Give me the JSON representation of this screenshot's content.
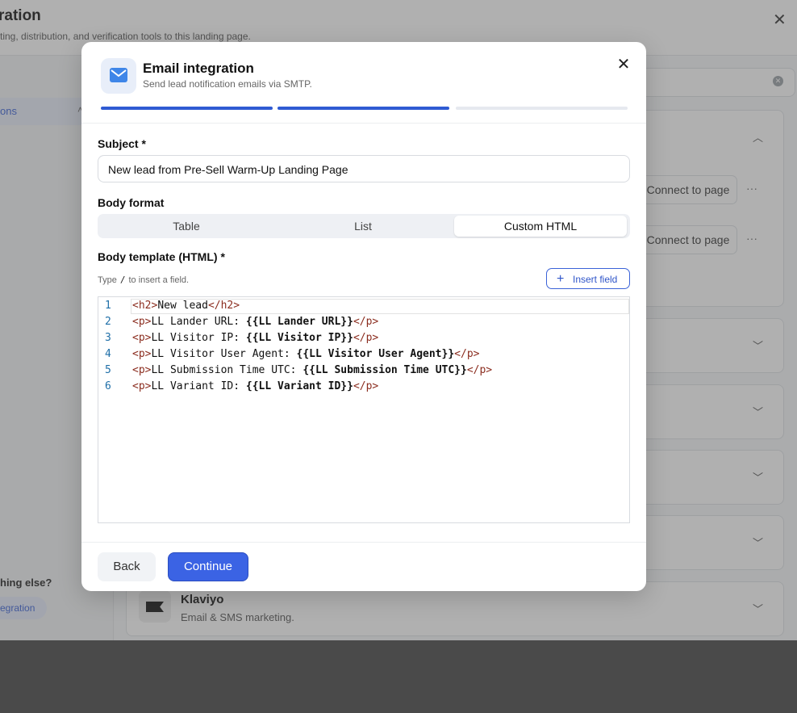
{
  "background": {
    "title": "ration",
    "subtitle": "ting, distribution, and verification tools to this landing page.",
    "sidebar_active": "ons",
    "help_title": "hing else?",
    "help_link": "egration",
    "connect_label": "Connect to page",
    "more_label": "···",
    "klaviyo": {
      "name": "Klaviyo",
      "description": "Email & SMS marketing."
    }
  },
  "modal": {
    "title": "Email integration",
    "subtitle": "Send lead notification emails via SMTP.",
    "steps": {
      "total": 3,
      "completed": 2
    },
    "subject": {
      "label": "Subject *",
      "value": "New lead from Pre-Sell Warm-Up Landing Page"
    },
    "body_format": {
      "label": "Body format",
      "options": [
        "Table",
        "List",
        "Custom HTML"
      ],
      "selected": "Custom HTML"
    },
    "body_template": {
      "label": "Body template (HTML) *",
      "hint_prefix": "Type",
      "hint_key": "/",
      "hint_suffix": "to insert a field.",
      "insert_label": "Insert field",
      "lines": [
        {
          "n": "1",
          "before": "",
          "tag_open": "<h2>",
          "text": "New lead",
          "var": "",
          "tag_close": "</h2>"
        },
        {
          "n": "2",
          "tag_open": "<p>",
          "text": "LL Lander URL: ",
          "var": "{{LL Lander URL}}",
          "tag_close": "</p>"
        },
        {
          "n": "3",
          "tag_open": "<p>",
          "text": "LL Visitor IP: ",
          "var": "{{LL Visitor IP}}",
          "tag_close": "</p>"
        },
        {
          "n": "4",
          "tag_open": "<p>",
          "text": "LL Visitor User Agent: ",
          "var": "{{LL Visitor User Agent}}",
          "tag_close": "</p>"
        },
        {
          "n": "5",
          "tag_open": "<p>",
          "text": "LL Submission Time UTC: ",
          "var": "{{LL Submission Time UTC}}",
          "tag_close": "</p>"
        },
        {
          "n": "6",
          "tag_open": "<p>",
          "text": "LL Variant ID: ",
          "var": "{{LL Variant ID}}",
          "tag_close": "</p>"
        }
      ]
    },
    "footer": {
      "back_label": "Back",
      "continue_label": "Continue"
    },
    "colors": {
      "accent": "#3b63e4",
      "step_done": "#2f5bd3",
      "step_todo": "#e6e9ef"
    }
  }
}
